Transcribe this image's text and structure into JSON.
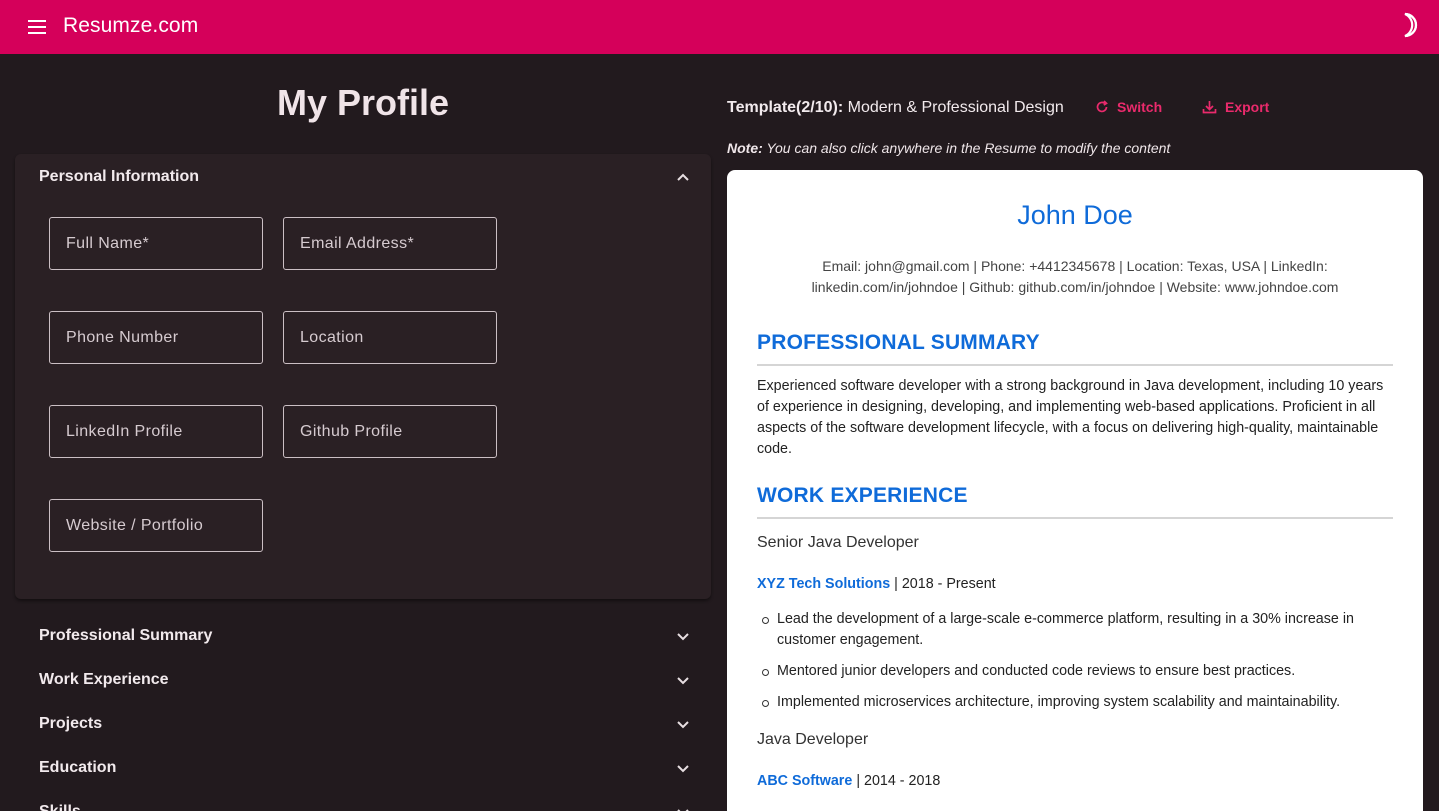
{
  "app": {
    "title": "Resumze.com",
    "accent": "#d5005a"
  },
  "left": {
    "page_title": "My Profile",
    "personal": {
      "heading": "Personal Information",
      "fields": {
        "full_name": "Full Name*",
        "email": "Email Address*",
        "phone": "Phone Number",
        "location": "Location",
        "linkedin": "LinkedIn Profile",
        "github": "Github Profile",
        "website": "Website / Portfolio"
      }
    },
    "sections": [
      "Professional Summary",
      "Work Experience",
      "Projects",
      "Education",
      "Skills"
    ]
  },
  "template": {
    "label": "Template(2/10):",
    "name": "Modern & Professional Design",
    "switch_label": "Switch",
    "export_label": "Export",
    "note_label": "Note:",
    "note_text": "You can also click anywhere in the Resume to modify the content"
  },
  "resume": {
    "name": "John Doe",
    "contact_line1": "Email: john@gmail.com | Phone: +4412345678 | Location: Texas, USA | LinkedIn:",
    "contact_line2": "linkedin.com/in/johndoe | Github: github.com/in/johndoe | Website: www.johndoe.com",
    "summary_heading": "PROFESSIONAL SUMMARY",
    "summary_text": "Experienced software developer with a strong background in Java development, including 10 years of experience in designing, developing, and implementing web-based applications. Proficient in all aspects of the software development lifecycle, with a focus on delivering high-quality, maintainable code.",
    "work_heading": "WORK EXPERIENCE",
    "jobs": [
      {
        "role": "Senior Java Developer",
        "company": "XYZ Tech Solutions",
        "dates": "| 2018 - Present",
        "bullets": [
          "Lead the development of a large-scale e-commerce platform, resulting in a 30% increase in customer engagement.",
          "Mentored junior developers and conducted code reviews to ensure best practices.",
          "Implemented microservices architecture, improving system scalability and maintainability."
        ]
      },
      {
        "role": "Java Developer",
        "company": "ABC Software",
        "dates": "| 2014 - 2018"
      }
    ]
  }
}
